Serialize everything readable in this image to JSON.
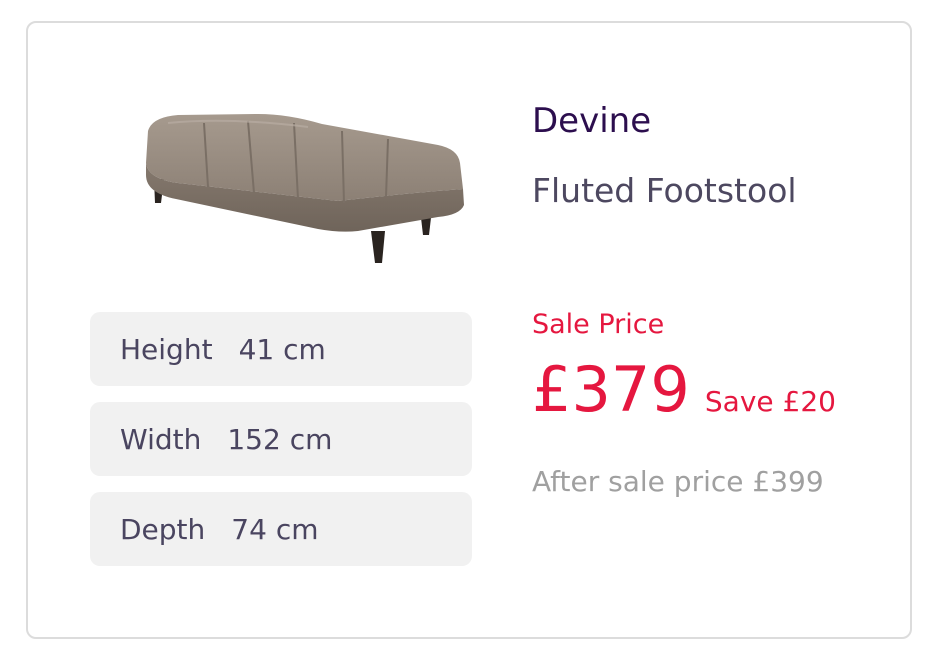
{
  "product": {
    "brand": "Devine",
    "name": "Fluted Footstool",
    "image_alt": "Fluted footstool in taupe fabric"
  },
  "dimensions": [
    {
      "label": "Height",
      "value": "41 cm"
    },
    {
      "label": "Width",
      "value": "152 cm"
    },
    {
      "label": "Depth",
      "value": "74 cm"
    }
  ],
  "pricing": {
    "sale_label": "Sale Price",
    "price": "£379",
    "save": "Save £20",
    "after_sale": "After sale price £399"
  },
  "colors": {
    "brand_purple": "#2c0e4e",
    "sale_red": "#e5173f",
    "muted_grey": "#a0a0a0",
    "row_bg": "#f1f1f1",
    "fabric": "#8e8276"
  }
}
